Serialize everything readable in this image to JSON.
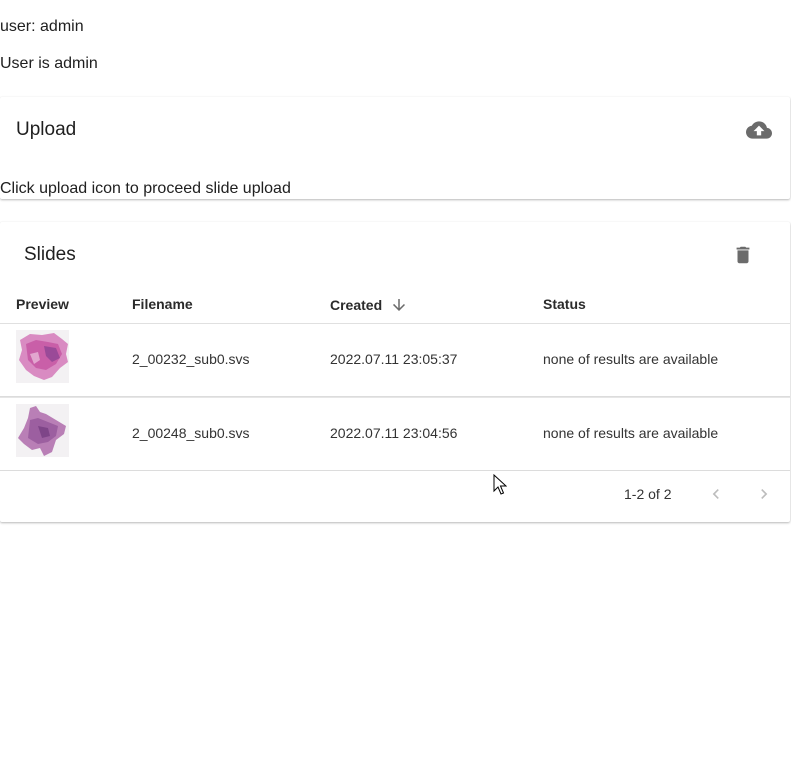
{
  "user": {
    "line1": "user: admin",
    "line2": "User is admin"
  },
  "upload": {
    "title": "Upload",
    "hint": "Click upload icon to proceed slide upload",
    "icon": "cloud-upload-icon"
  },
  "slides": {
    "title": "Slides",
    "delete_icon": "trash-icon",
    "columns": {
      "preview": "Preview",
      "filename": "Filename",
      "created": "Created",
      "status": "Status"
    },
    "rows": [
      {
        "filename": "2_00232_sub0.svs",
        "created": "2022.07.11 23:05:37",
        "status": "none of results are available"
      },
      {
        "filename": "2_00248_sub0.svs",
        "created": "2022.07.11 23:04:56",
        "status": "none of results are available"
      }
    ],
    "pagination": {
      "range": "1-2 of 2"
    }
  },
  "colors": {
    "icon": "#6b6b6b",
    "icon_disabled": "#bdbdbd",
    "divider": "#e0e0e0"
  }
}
